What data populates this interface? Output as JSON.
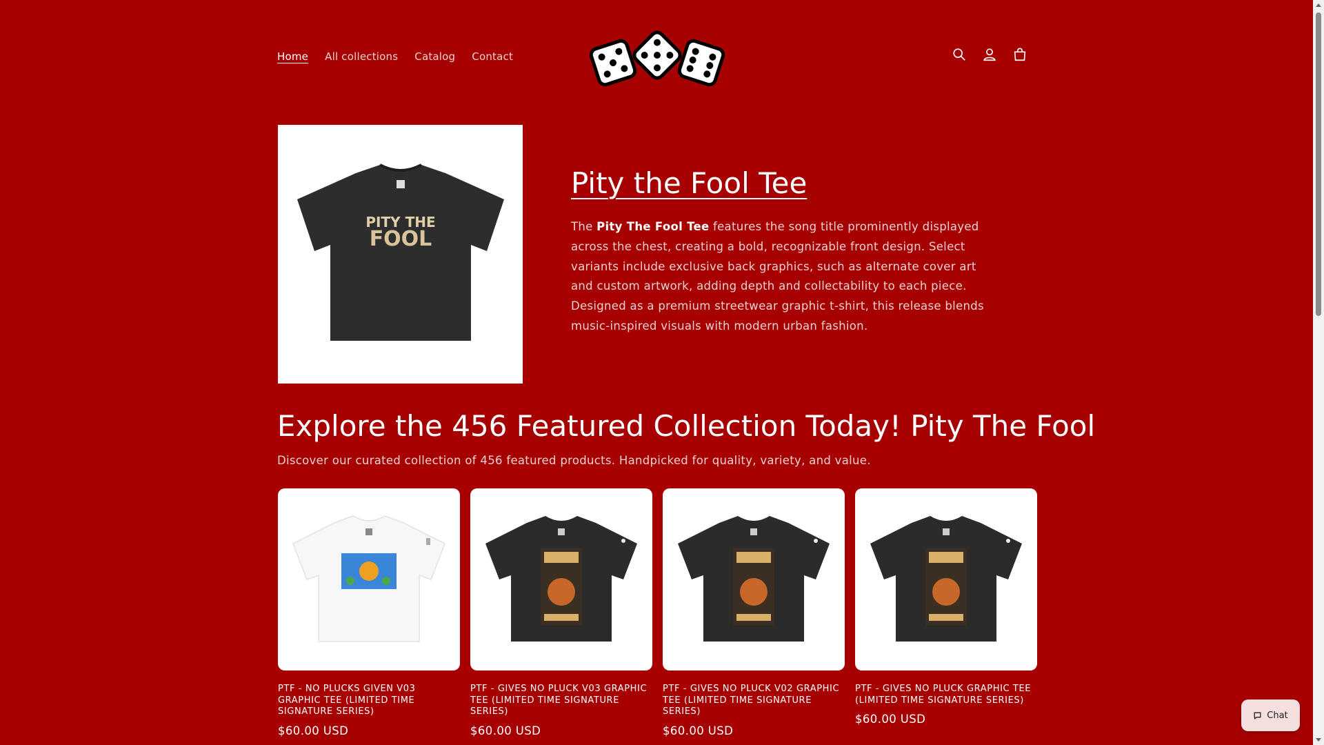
{
  "nav": {
    "items": [
      {
        "label": "Home",
        "active": true
      },
      {
        "label": "All collections",
        "active": false
      },
      {
        "label": "Catalog",
        "active": false
      },
      {
        "label": "Contact",
        "active": false
      }
    ]
  },
  "header": {
    "logo_icon": "three-dice-logo",
    "icons": [
      "search-icon",
      "account-icon",
      "cart-icon"
    ]
  },
  "hero": {
    "title": "Pity the Fool Tee",
    "desc_prefix": "The ",
    "desc_bold": "Pity The Fool Tee",
    "desc_rest": " features the song title prominently displayed across the chest, creating a bold, recognizable front design. Select variants include exclusive back graphics, such as alternate cover art and custom artwork, adding depth and collectability to each piece. Designed as a premium streetwear graphic t-shirt, this release blends music-inspired visuals with modern urban fashion.",
    "shirt_print_line1": "PITY THE",
    "shirt_print_line2": "FOOL"
  },
  "collection": {
    "title": "Explore the 456 Featured Collection Today! Pity The Fool",
    "subtitle": "Discover our curated collection of 456 featured products. Handpicked for quality, variety, and value.",
    "products": [
      {
        "title": "PTF - NO PLUCKS GIVEN V03 GRAPHIC TEE (LIMITED TIME SIGNATURE SERIES)",
        "price": "$60.00 USD",
        "shirt_color": "white"
      },
      {
        "title": "PTF - GIVES NO PLUCK V03 GRAPHIC TEE (LIMITED TIME SIGNATURE SERIES)",
        "price": "$60.00 USD",
        "shirt_color": "black"
      },
      {
        "title": "PTF - GIVES NO PLUCK V02 GRAPHIC TEE (LIMITED TIME SIGNATURE SERIES)",
        "price": "$60.00 USD",
        "shirt_color": "black"
      },
      {
        "title": "PTF - GIVES NO PLUCK GRAPHIC TEE (LIMITED TIME SIGNATURE SERIES)",
        "price": "$60.00 USD",
        "shirt_color": "black"
      }
    ]
  },
  "chat": {
    "label": "Chat",
    "icon": "chat-bubble-icon"
  },
  "colors": {
    "background": "#a70000",
    "text": "#ffffff",
    "card_bg": "#ffffff"
  }
}
